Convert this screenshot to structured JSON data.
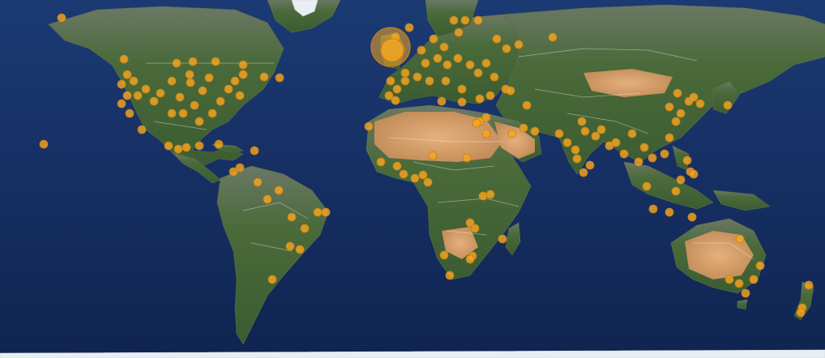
{
  "map": {
    "type": "world-satellite-map",
    "marker_color": "#f5a623",
    "marker_stroke": "#c97f10",
    "ocean_color": "#14305f",
    "land_color": "#3e5a34",
    "desert_color": "#c98f5a"
  }
}
